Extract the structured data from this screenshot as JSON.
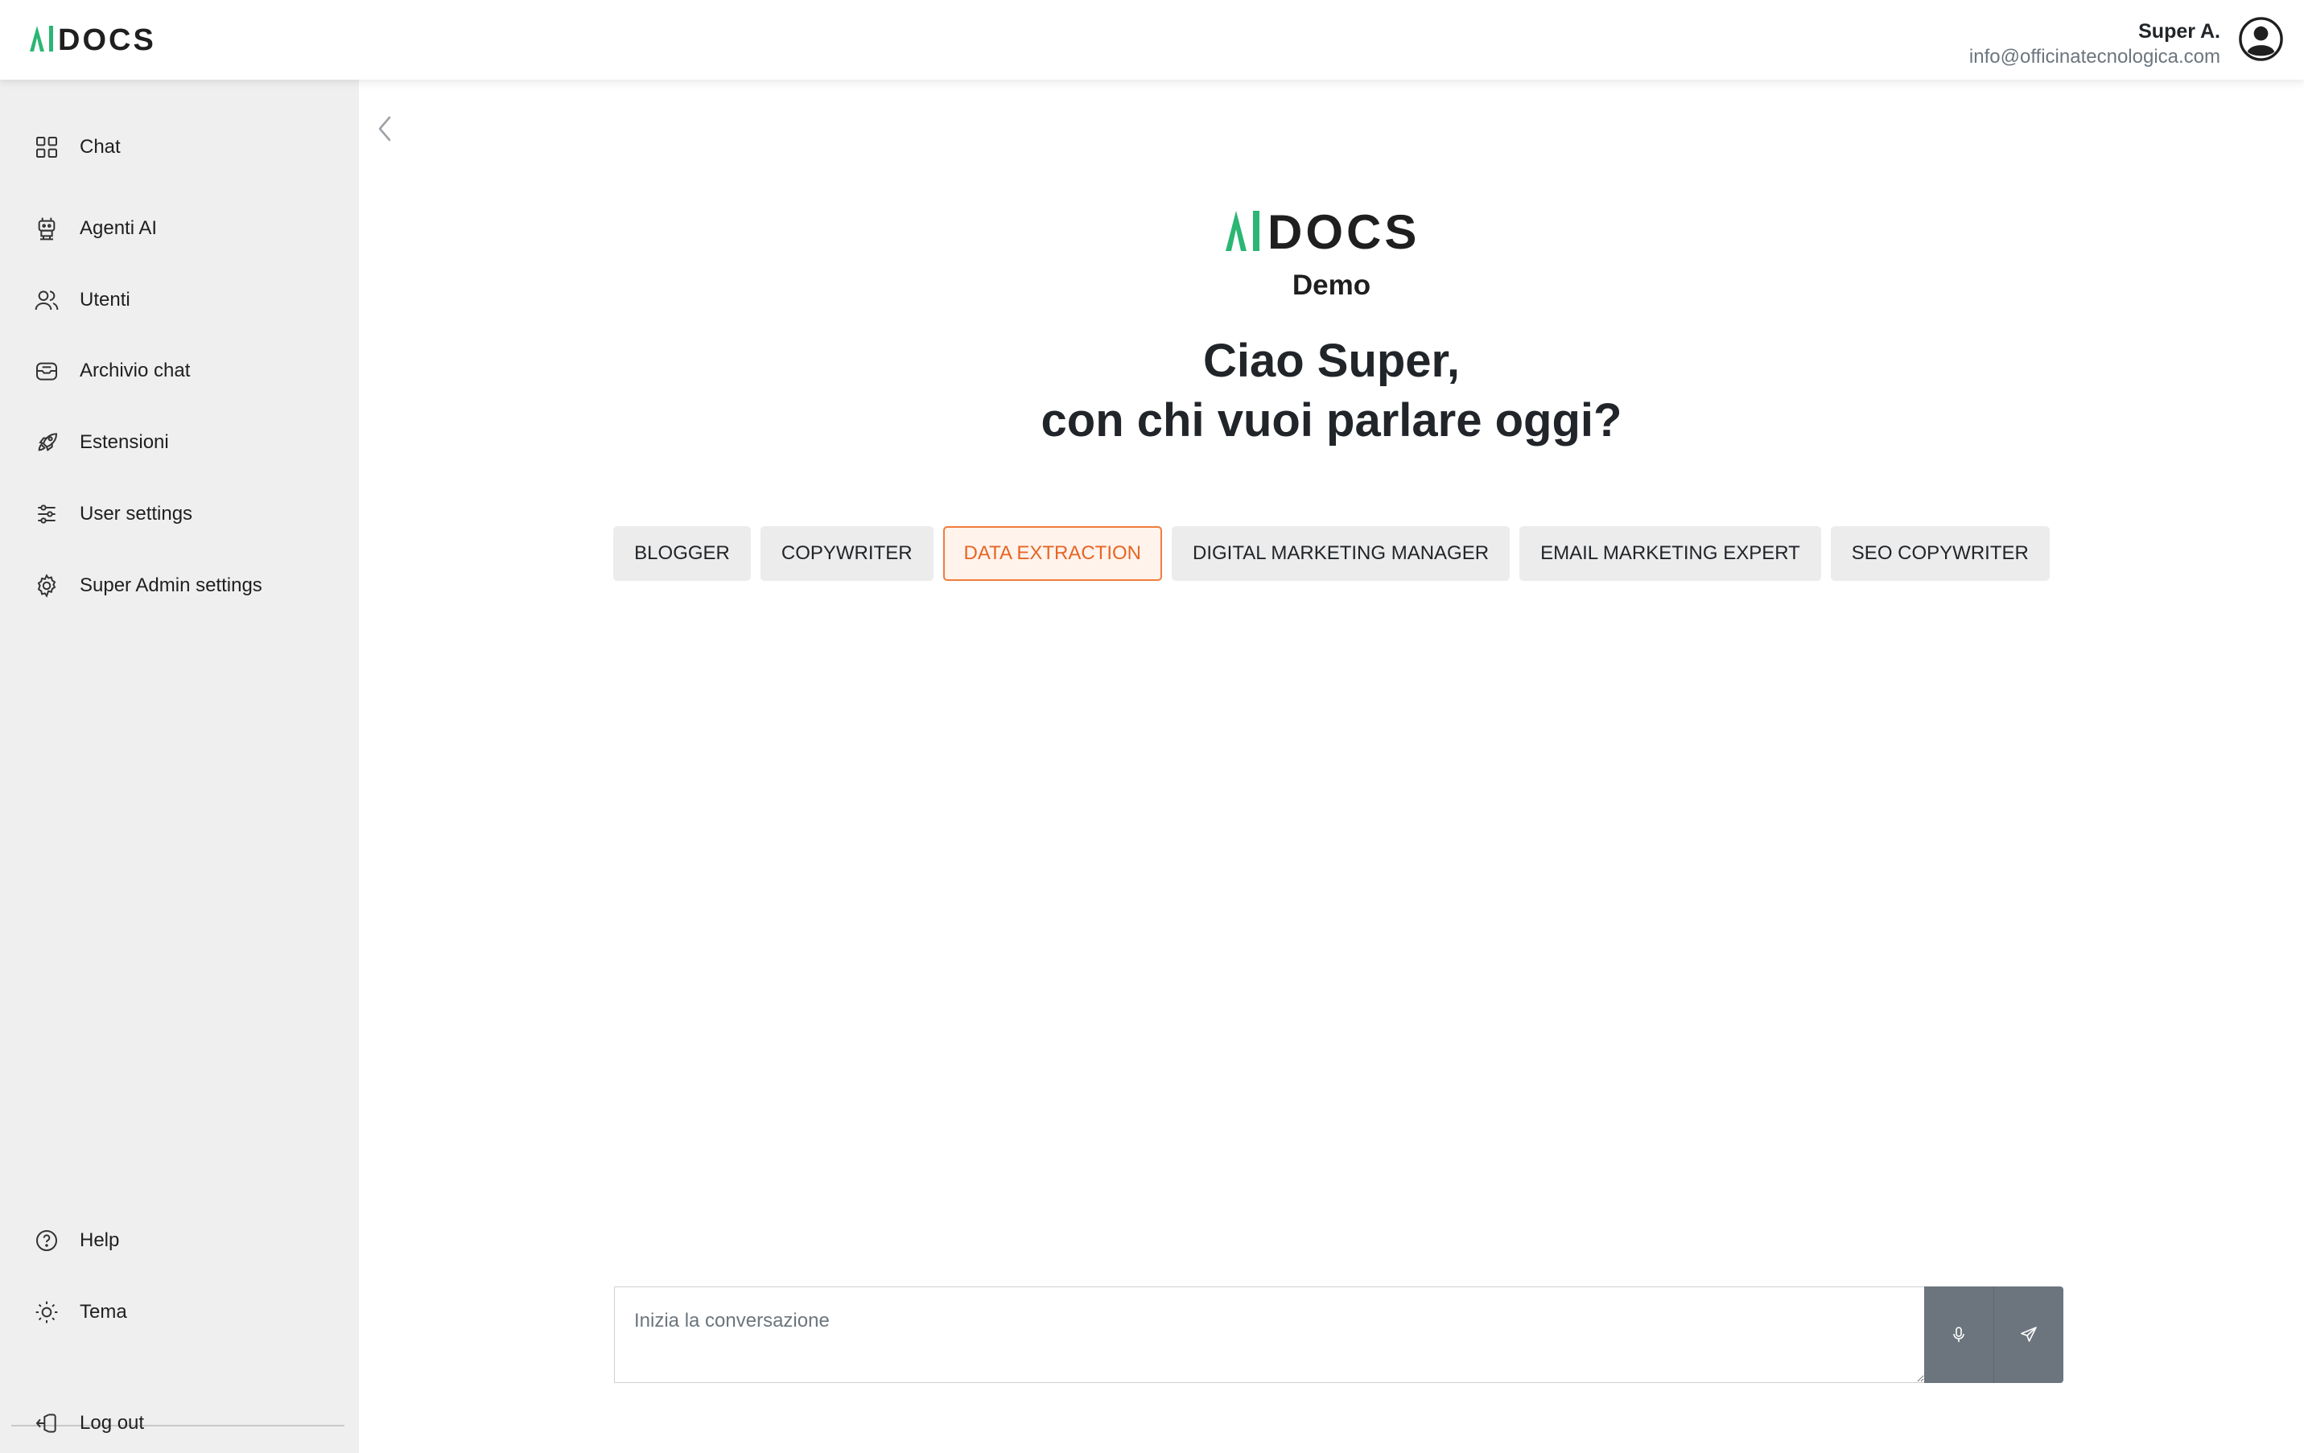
{
  "brand": {
    "logo_text": "AIDOCS",
    "accent_green": "#2bb673",
    "dark": "#1f1f1f"
  },
  "header": {
    "user_name": "Super A.",
    "user_email": "info@officinatecnologica.com",
    "avatar_icon": "user-circle-icon"
  },
  "sidebar": {
    "items": [
      {
        "label": "Chat",
        "icon": "grid-icon"
      },
      {
        "label": "Agenti AI",
        "icon": "robot-icon"
      },
      {
        "label": "Utenti",
        "icon": "users-icon"
      },
      {
        "label": "Archivio chat",
        "icon": "inbox-icon"
      },
      {
        "label": "Estensioni",
        "icon": "rocket-icon"
      },
      {
        "label": "User settings",
        "icon": "sliders-icon"
      },
      {
        "label": "Super Admin settings",
        "icon": "gear-icon"
      }
    ],
    "bottom_items": [
      {
        "label": "Help",
        "icon": "help-circle-icon"
      },
      {
        "label": "Tema",
        "icon": "sun-icon"
      },
      {
        "label": "Log out",
        "icon": "logout-icon"
      }
    ]
  },
  "main": {
    "org_name": "Demo",
    "greeting_line1": "Ciao Super,",
    "greeting_line2": "con chi vuoi parlare oggi?",
    "agents": [
      {
        "label": "BLOGGER",
        "active": false
      },
      {
        "label": "COPYWRITER",
        "active": false
      },
      {
        "label": "DATA EXTRACTION",
        "active": true
      },
      {
        "label": "DIGITAL MARKETING MANAGER",
        "active": false
      },
      {
        "label": "EMAIL MARKETING EXPERT",
        "active": false
      },
      {
        "label": "SEO COPYWRITER",
        "active": false
      }
    ],
    "active_color": "#e86524"
  },
  "composer": {
    "placeholder": "Inizia la conversazione",
    "value": "",
    "mic_icon": "microphone-icon",
    "send_icon": "send-icon"
  }
}
